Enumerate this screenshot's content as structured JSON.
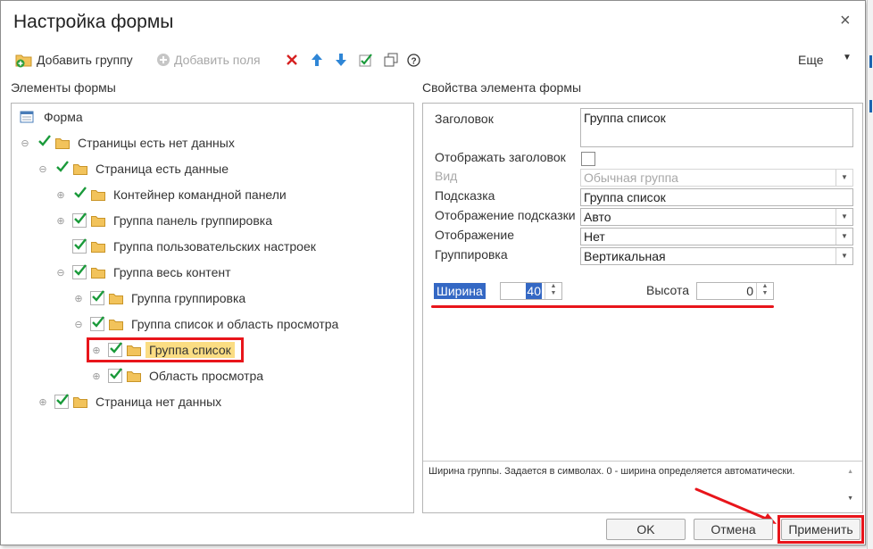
{
  "window": {
    "title": "Настройка формы",
    "close_glyph": "×"
  },
  "toolbar": {
    "add_group": "Добавить группу",
    "add_fields": "Добавить поля",
    "more": "Еще",
    "icons": [
      "delete-icon",
      "move-up-icon",
      "move-down-icon",
      "check-all-icon",
      "copy-icon",
      "help-icon"
    ]
  },
  "left": {
    "label": "Элементы формы",
    "tree": [
      {
        "label": "Форма"
      },
      {
        "label": "Страницы есть нет данных"
      },
      {
        "label": "Страница есть данные"
      },
      {
        "label": "Контейнер командной панели"
      },
      {
        "label": "Группа панель группировка"
      },
      {
        "label": "Группа пользовательских настроек"
      },
      {
        "label": "Группа весь контент"
      },
      {
        "label": "Группа группировка"
      },
      {
        "label": "Группа список и область просмотра"
      },
      {
        "label": "Группа список",
        "selected": true
      },
      {
        "label": "Область просмотра"
      },
      {
        "label": "Страница нет данных"
      }
    ]
  },
  "right": {
    "label": "Свойства элемента формы",
    "props": {
      "title_label": "Заголовок",
      "title_value": "Группа список",
      "show_title_label": "Отображать заголовок",
      "view_label": "Вид",
      "view_value": "Обычная группа",
      "hint_label": "Подсказка",
      "hint_value": "Группа список",
      "hint_display_label": "Отображение подсказки",
      "hint_display_value": "Авто",
      "display_label": "Отображение",
      "display_value": "Нет",
      "grouping_label": "Группировка",
      "grouping_value": "Вертикальная",
      "width_label": "Ширина",
      "width_value": "40",
      "height_label": "Высота",
      "height_value": "0"
    },
    "hint_text": "Ширина группы. Задается в символах. 0 - ширина определяется автоматически."
  },
  "buttons": {
    "ok": "OK",
    "cancel": "Отмена",
    "apply": "Применить"
  },
  "colors": {
    "accent_red": "#e8151b",
    "selection_bg": "#fbdd83",
    "check_green": "#1a9a3a",
    "folder": "#f2c35b"
  }
}
